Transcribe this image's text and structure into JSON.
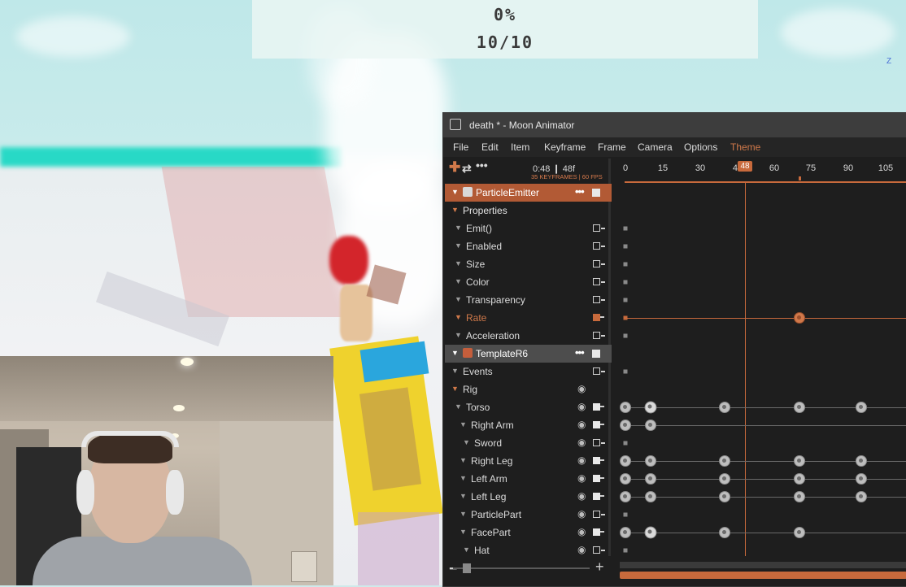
{
  "hud": {
    "percent": "0%",
    "count": "10/10"
  },
  "viewport": {
    "axis_label": "Z"
  },
  "window": {
    "title": "death * - Moon Animator"
  },
  "menu": [
    "File",
    "Edit",
    "Item",
    "Keyframe",
    "Frame",
    "Camera",
    "Options",
    "Theme"
  ],
  "toolbar": {
    "time": "0:48 ❙ 48f",
    "info": "35 KEYFRAMES | 60 FPS"
  },
  "timeline": {
    "ticks": [
      "0",
      "15",
      "30",
      "45",
      "60",
      "75",
      "90",
      "105"
    ],
    "current_frame": "48"
  },
  "tracks": [
    {
      "label": "ParticleEmitter",
      "kind": "object"
    },
    {
      "label": "Properties",
      "kind": "folder"
    },
    {
      "label": "Emit()",
      "kind": "prop"
    },
    {
      "label": "Enabled",
      "kind": "prop"
    },
    {
      "label": "Size",
      "kind": "prop"
    },
    {
      "label": "Color",
      "kind": "prop"
    },
    {
      "label": "Transparency",
      "kind": "prop"
    },
    {
      "label": "Rate",
      "kind": "prop"
    },
    {
      "label": "Acceleration",
      "kind": "prop"
    },
    {
      "label": "TemplateR6",
      "kind": "object"
    },
    {
      "label": "Events",
      "kind": "prop"
    },
    {
      "label": "Rig",
      "kind": "folder"
    },
    {
      "label": "Torso",
      "kind": "part"
    },
    {
      "label": "Right Arm",
      "kind": "part"
    },
    {
      "label": "Sword",
      "kind": "part"
    },
    {
      "label": "Right Leg",
      "kind": "part"
    },
    {
      "label": "Left Arm",
      "kind": "part"
    },
    {
      "label": "Left Leg",
      "kind": "part"
    },
    {
      "label": "ParticlePart",
      "kind": "part"
    },
    {
      "label": "FacePart",
      "kind": "part"
    },
    {
      "label": "Hat",
      "kind": "part"
    }
  ],
  "colors": {
    "accent": "#c86a3c",
    "panel_bg": "#1e1e1e",
    "titlebar": "#3d3d3d",
    "hud_text": "#3a3a3a"
  },
  "icons": [
    "moon-animator-icon",
    "add-icon",
    "loop-icon",
    "more-icon",
    "eye-icon"
  ]
}
